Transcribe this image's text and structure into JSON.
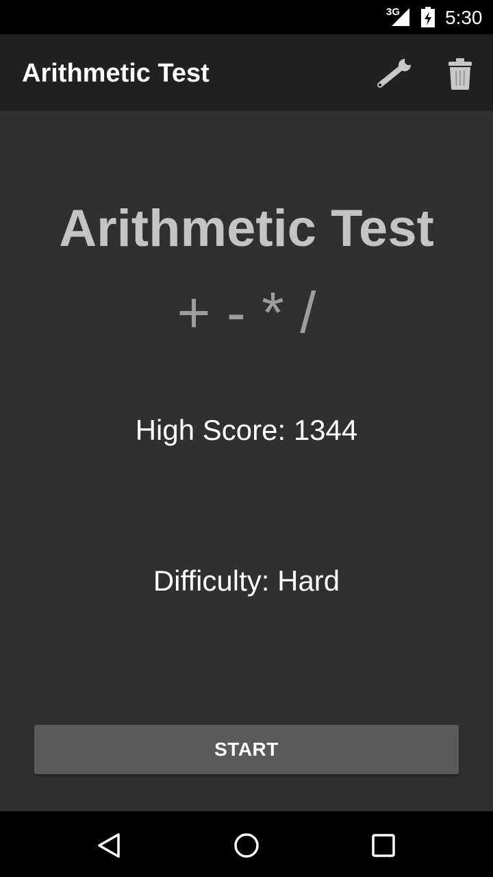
{
  "status_bar": {
    "network": "3G",
    "time": "5:30",
    "icons": [
      "signal-icon",
      "battery-charging-icon"
    ]
  },
  "app_bar": {
    "title": "Arithmetic Test",
    "actions": [
      {
        "name": "settings",
        "icon": "wrench-icon"
      },
      {
        "name": "delete",
        "icon": "trash-icon"
      }
    ]
  },
  "main": {
    "hero_title": "Arithmetic Test",
    "operators": "+ - * /",
    "high_score_label": "High Score: 1344",
    "difficulty_label": "Difficulty: Hard",
    "start_label": "START"
  },
  "nav_bar": {
    "icons": [
      "back-icon",
      "home-icon",
      "recents-icon"
    ]
  },
  "colors": {
    "background": "#303030",
    "app_bar": "#212121",
    "button": "#5a5a5b",
    "hero_text": "#c4c4c4",
    "operators_text": "#9d9d9d"
  }
}
